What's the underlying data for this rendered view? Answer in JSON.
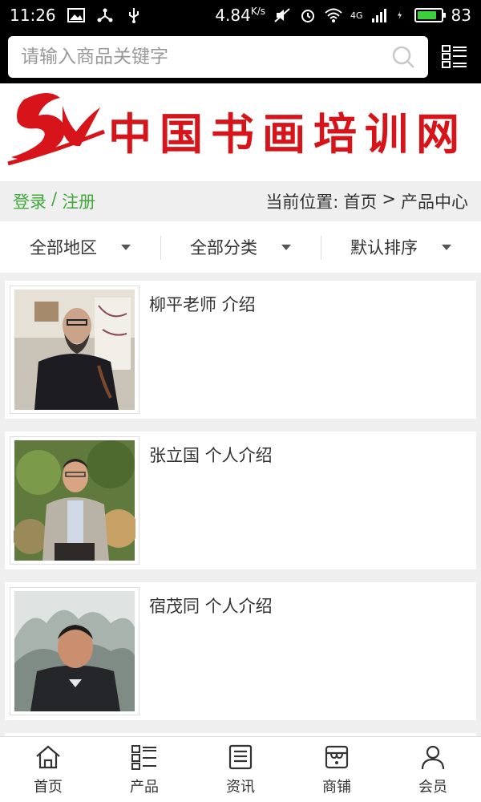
{
  "status": {
    "time": "11:26",
    "speed": "4.84",
    "speed_unit": "K/s",
    "network": "4G",
    "battery": "83",
    "battery_level": 0.83
  },
  "search": {
    "placeholder": "请输入商品关键字"
  },
  "banner": {
    "logo_text": "中国书画培训网"
  },
  "auth": {
    "login": "登录",
    "separator": "/",
    "register": "注册"
  },
  "breadcrumb": {
    "prefix": "当前位置:",
    "home": "首页",
    "separator": ">",
    "current": "产品中心"
  },
  "filters": [
    {
      "label": "全部地区"
    },
    {
      "label": "全部分类"
    },
    {
      "label": "默认排序"
    }
  ],
  "products": [
    {
      "title": "柳平老师 介绍"
    },
    {
      "title": "张立国 个人介绍"
    },
    {
      "title": "宿茂同 个人介绍"
    }
  ],
  "nav": [
    {
      "label": "首页",
      "icon": "home-icon"
    },
    {
      "label": "产品",
      "icon": "grid-list-icon"
    },
    {
      "label": "资讯",
      "icon": "news-icon"
    },
    {
      "label": "商铺",
      "icon": "store-icon"
    },
    {
      "label": "会员",
      "icon": "user-icon"
    }
  ],
  "colors": {
    "accent_green": "#41a93b",
    "logo_red": "#d7141a"
  }
}
